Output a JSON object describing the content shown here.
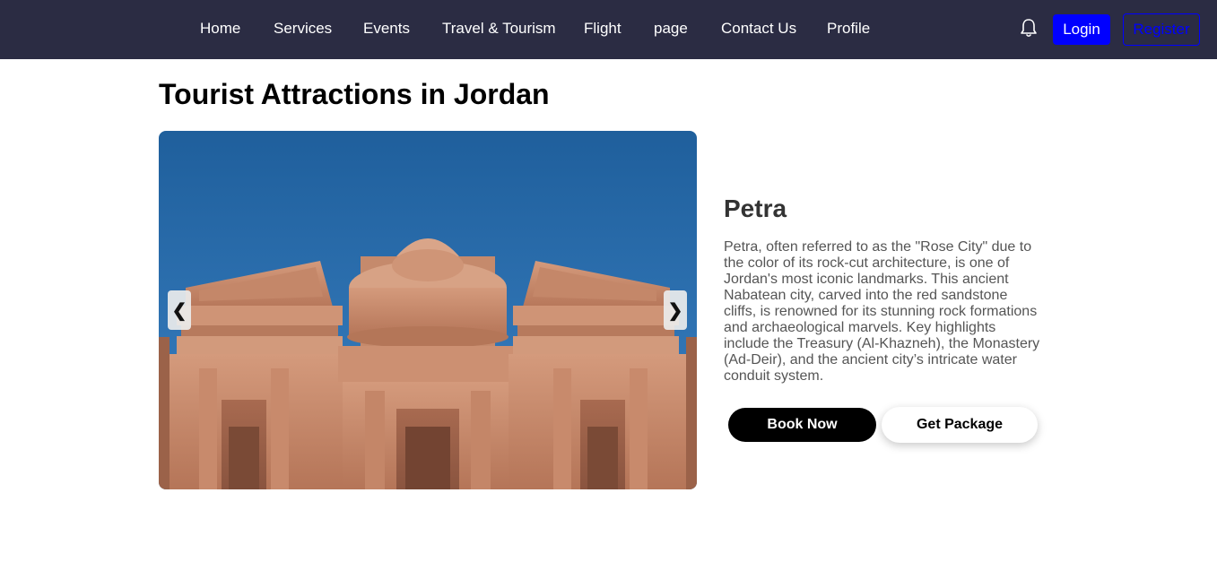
{
  "nav": {
    "items": [
      {
        "label": "Home"
      },
      {
        "label": "Services"
      },
      {
        "label": "Events"
      },
      {
        "label": "Travel & Tourism"
      },
      {
        "label": "Flight"
      },
      {
        "label": "page"
      },
      {
        "label": "Contact Us"
      },
      {
        "label": "Profile"
      }
    ],
    "bell_icon": "bell-icon",
    "login_label": "Login",
    "register_label": "Register"
  },
  "page": {
    "title": "Tourist Attractions in Jordan"
  },
  "carousel": {
    "prev_glyph": "❮",
    "next_glyph": "❯",
    "image_subject": "petra-monastery-photo"
  },
  "attraction": {
    "name": "Petra",
    "description": "Petra, often referred to as the \"Rose City\" due to the color of its rock-cut architecture, is one of Jordan's most iconic landmarks. This ancient Nabatean city, carved into the red sandstone cliffs, is renowned for its stunning rock formations and archaeological marvels. Key highlights include the Treasury (Al-Khazneh), the Monastery (Ad-Deir), and the ancient city’s intricate water conduit system.",
    "book_label": "Book Now",
    "package_label": "Get Package"
  },
  "colors": {
    "navbar_bg": "#2b2c43",
    "primary_blue": "#0000ff",
    "sky": "#2a6aa8",
    "sandstone": "#c98d6e"
  }
}
